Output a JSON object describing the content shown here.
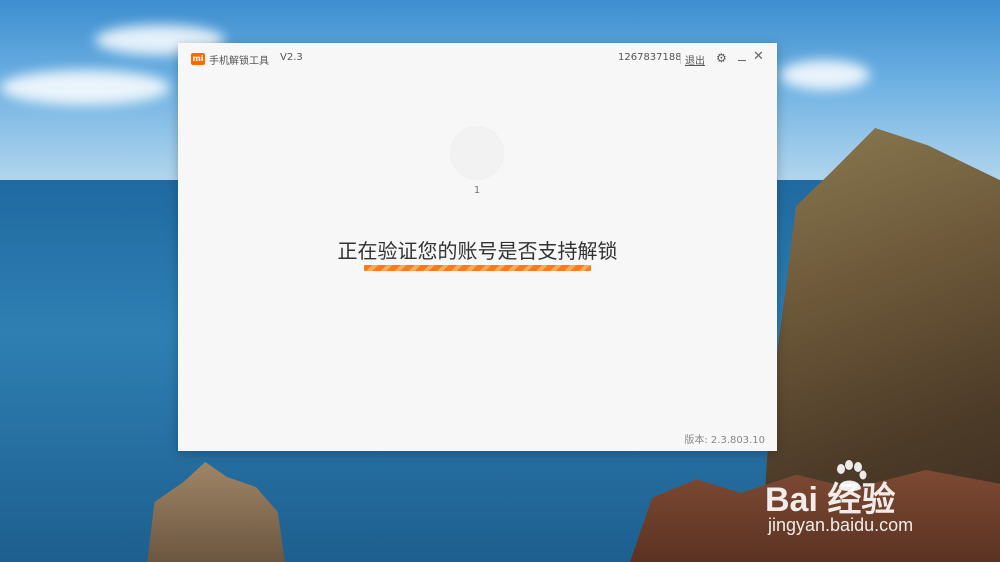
{
  "window": {
    "app_title": "手机解锁工具",
    "version": "V2.3",
    "logo_icon": "mi-logo-icon",
    "logo_text": "mi"
  },
  "header": {
    "account_id": "1267837188",
    "logout_label": "退出",
    "icons": [
      "gear-icon",
      "minimize-icon",
      "close-icon"
    ]
  },
  "main": {
    "avatar_label": "1",
    "status_text": "正在验证您的账号是否支持解锁",
    "progress_color": "#ff7a1a"
  },
  "footer": {
    "version_text": "版本: 2.3.803.10"
  },
  "watermark": {
    "brand_text": "Bai  经验",
    "url": "jingyan.baidu.com"
  },
  "colors": {
    "accent": "#ff6a00",
    "window_bg": "#f7f7f7"
  }
}
